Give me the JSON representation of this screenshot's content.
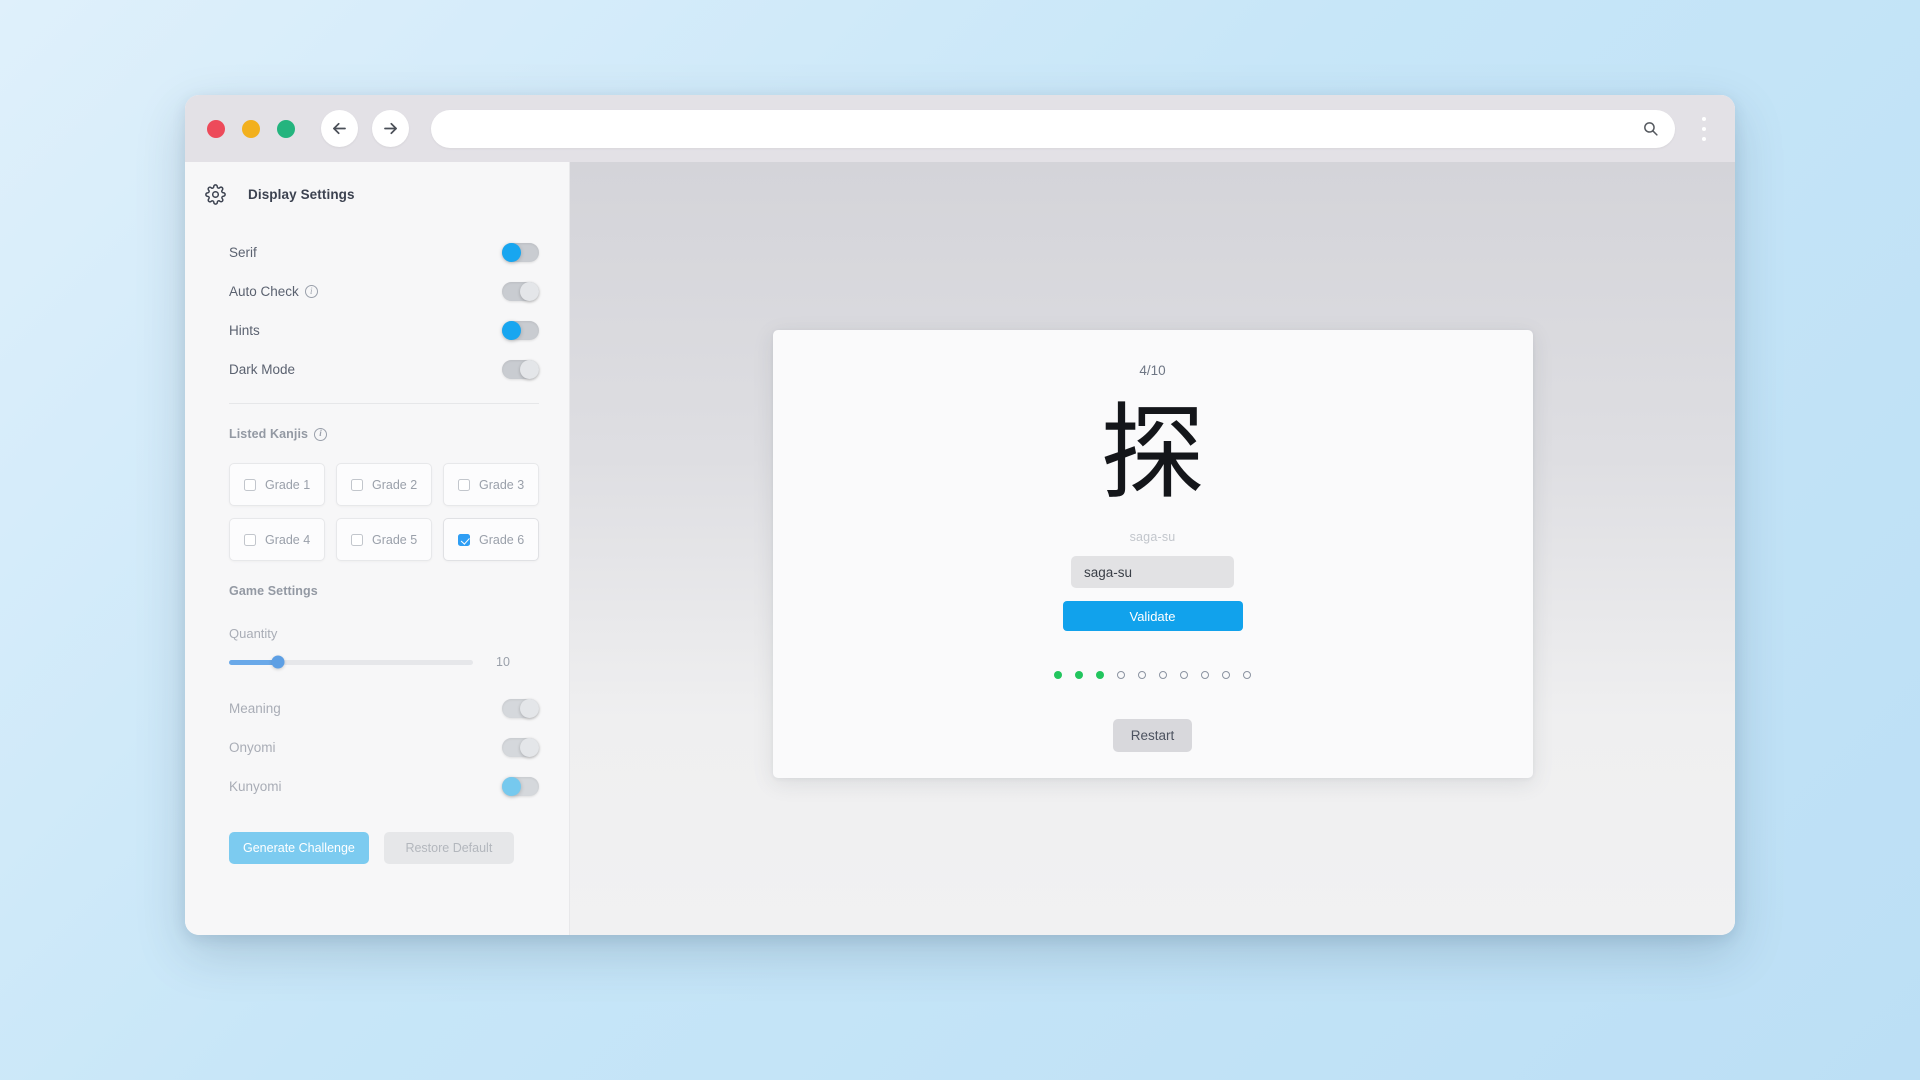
{
  "browser": {
    "traffic_lights": [
      "close",
      "minimize",
      "maximize"
    ],
    "back_label": "Back",
    "forward_label": "Forward",
    "url_value": "",
    "url_placeholder": "",
    "search_icon": "search-icon",
    "menu_icon": "kebab-menu-icon"
  },
  "sidebar": {
    "gear_icon": "gear-icon",
    "title": "Display Settings",
    "display_settings": [
      {
        "label": "Serif",
        "has_info": false,
        "state": "on",
        "faded": false
      },
      {
        "label": "Auto Check",
        "has_info": true,
        "state": "off",
        "faded": false
      },
      {
        "label": "Hints",
        "has_info": false,
        "state": "on",
        "faded": false
      },
      {
        "label": "Dark Mode",
        "has_info": false,
        "state": "off",
        "faded": false
      }
    ],
    "listed_kanjis": {
      "title": "Listed Kanjis",
      "has_info": true,
      "grades": [
        {
          "label": "Grade 1",
          "checked": false
        },
        {
          "label": "Grade 2",
          "checked": false
        },
        {
          "label": "Grade 3",
          "checked": false
        },
        {
          "label": "Grade 4",
          "checked": false
        },
        {
          "label": "Grade 5",
          "checked": false
        },
        {
          "label": "Grade 6",
          "checked": true
        }
      ]
    },
    "game_settings": {
      "title": "Game Settings",
      "quantity": {
        "label": "Quantity",
        "value": "10",
        "percent": 20,
        "min": 1,
        "max": 50
      },
      "toggles": [
        {
          "label": "Meaning",
          "state": "off",
          "faded": true
        },
        {
          "label": "Onyomi",
          "state": "off",
          "faded": true
        },
        {
          "label": "Kunyomi",
          "state": "on",
          "faded": true
        }
      ],
      "generate_label": "Generate Challenge",
      "restore_label": "Restore Default"
    }
  },
  "main": {
    "counter": "4/10",
    "kanji": "探",
    "hint": "saga-su",
    "answer_value": "saga-su",
    "answer_placeholder": "",
    "validate_label": "Validate",
    "restart_label": "Restart",
    "progress": {
      "total": 10,
      "states": [
        "correct",
        "correct",
        "correct",
        "empty",
        "empty",
        "empty",
        "empty",
        "empty",
        "empty",
        "empty"
      ]
    }
  },
  "colors": {
    "accent_blue": "#11a2ec",
    "accent_blue_faded": "#7ccbf0",
    "slider_blue": "#6aa9e9",
    "success_green": "#22c55e",
    "traffic_red": "#ed4a5a",
    "traffic_yellow": "#f2b01e",
    "traffic_green": "#24b47e"
  }
}
